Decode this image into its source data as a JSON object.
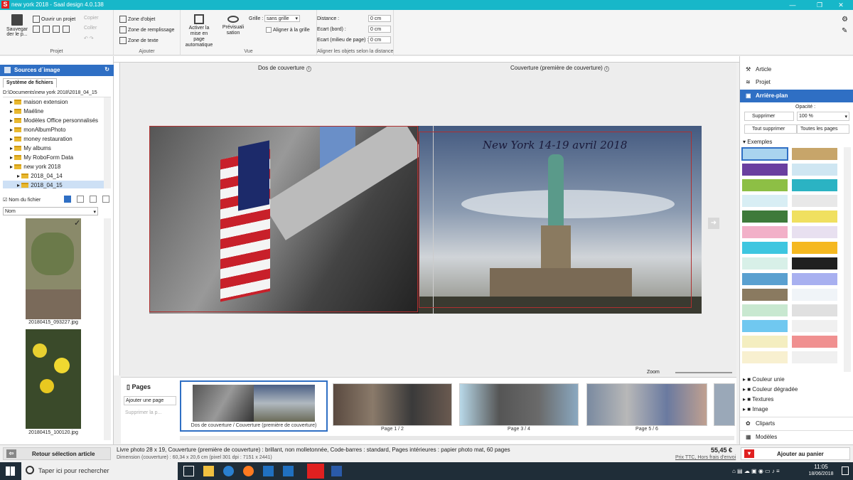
{
  "window": {
    "title": "new york 2018 - Saal design 4.0.138",
    "logo": "S"
  },
  "ribbon": {
    "save": "Sauvegar der le p...",
    "open_project": "Ouvrir un projet",
    "copy": "Copier",
    "paste": "Coller",
    "group_projet": "Projet",
    "zone_objet": "Zone d'objet",
    "zone_remplissage": "Zone de remplissage",
    "zone_texte": "Zone de texte",
    "group_ajouter": "Ajouter",
    "auto_layout": "Activer la mise en page automatique",
    "preview": "Prévisuali sation",
    "grid_label": "Grille :",
    "grid_value": "sans grille",
    "align_grid": "Aligner à la grille",
    "group_vue": "Vue",
    "distance_label": "Distance :",
    "edge_label": "Ecart (bord) :",
    "middle_label": "Ecart (milieu de page) :",
    "distance_value": "0 cm",
    "edge_value": "0 cm",
    "middle_value": "0 cm",
    "group_align": "Aligner les objets selon la distance"
  },
  "left_panel": {
    "title": "Sources d´image",
    "tab": "Système de fichiers",
    "path": "D:\\Documents\\new york 2018\\2018_04_15",
    "tree": [
      {
        "label": "maison extension",
        "sel": false,
        "indent": 1
      },
      {
        "label": "Maéline",
        "sel": false,
        "indent": 1
      },
      {
        "label": "Modèles Office personnalisés",
        "sel": false,
        "indent": 1
      },
      {
        "label": "monAlbumPhoto",
        "sel": false,
        "indent": 1
      },
      {
        "label": "money restauration",
        "sel": false,
        "indent": 1
      },
      {
        "label": "My albums",
        "sel": false,
        "indent": 1
      },
      {
        "label": "My RoboForm Data",
        "sel": false,
        "indent": 1
      },
      {
        "label": "new york 2018",
        "sel": false,
        "indent": 1
      },
      {
        "label": "2018_04_14",
        "sel": false,
        "indent": 2
      },
      {
        "label": "2018_04_15",
        "sel": true,
        "indent": 2
      }
    ],
    "show_filename": "Nom du fichier",
    "sort_label": "Nom",
    "thumbs": [
      {
        "name": "20180415_093227.jpg"
      },
      {
        "name": "20180415_100120.jpg"
      }
    ],
    "back_button": "Retour sélection article"
  },
  "canvas": {
    "back_title": "Dos de couverture",
    "front_title": "Couverture (première de couverture)",
    "cover_text": "New York 14-19 avril 2018",
    "zoom_label": "Zoom"
  },
  "pages_strip": {
    "pages_label": "Pages",
    "add_page": "Ajouter une page",
    "delete_page": "Supprimer la p...",
    "thumbs": [
      {
        "label": "Dos de couverture / Couverture (première de couverture)"
      },
      {
        "label": "Page 1 / 2"
      },
      {
        "label": "Page 3 / 4"
      },
      {
        "label": "Page 5 / 6"
      }
    ]
  },
  "right_panel": {
    "article": "Article",
    "projet": "Projet",
    "arriere_plan": "Arrière-plan",
    "supprimer": "Supprimer",
    "opacity_label": "Opacité :",
    "opacity_value": "100 %",
    "tout_supprimer": "Tout supprimer",
    "toutes_pages": "Toutes les pages",
    "exemples": "Exemples",
    "sections": [
      "Couleur unie",
      "Couleur dégradée",
      "Textures",
      "Image"
    ],
    "cliparts": "Cliparts",
    "modeles": "Modèles",
    "add_cart": "Ajouter au panier",
    "swatches": [
      "#a9d4ef",
      "#c7a56a",
      "#6a3fa0",
      "#cfe6f2",
      "#8dbf45",
      "#2bb3c3",
      "#d8eef4",
      "#e8e8e8",
      "#3e7a3a",
      "#f0e060",
      "#f2b0c8",
      "#e8e0f0",
      "#3ec6e0",
      "#f5b820",
      "#d8f0e8",
      "#202020",
      "#5aa0d0",
      "#a8b0f0",
      "#8a7a60",
      "#f0f4f8",
      "#c8e8d0",
      "#e0e0e0",
      "#70c8f0",
      "#f0f0f0",
      "#f4eec0",
      "#f09090",
      "#f8f0d0",
      "#f0f0f0"
    ]
  },
  "status": {
    "line1": "Livre photo 28 x 19, Couverture (première de couverture) : brillant, non molletonnée, Code-barres : standard, Pages intérieures : papier photo mat, 60 pages",
    "line2": "Dimension (couverture) : 60,34 x 20,6 cm (pixel 301 dpi : 7151 x 2441)",
    "price": "55,45 €",
    "price_note": "Prix TTC, Hors frais d'envoi"
  },
  "taskbar": {
    "search": "Taper ici pour rechercher",
    "time": "11:05",
    "date": "18/06/2018"
  }
}
